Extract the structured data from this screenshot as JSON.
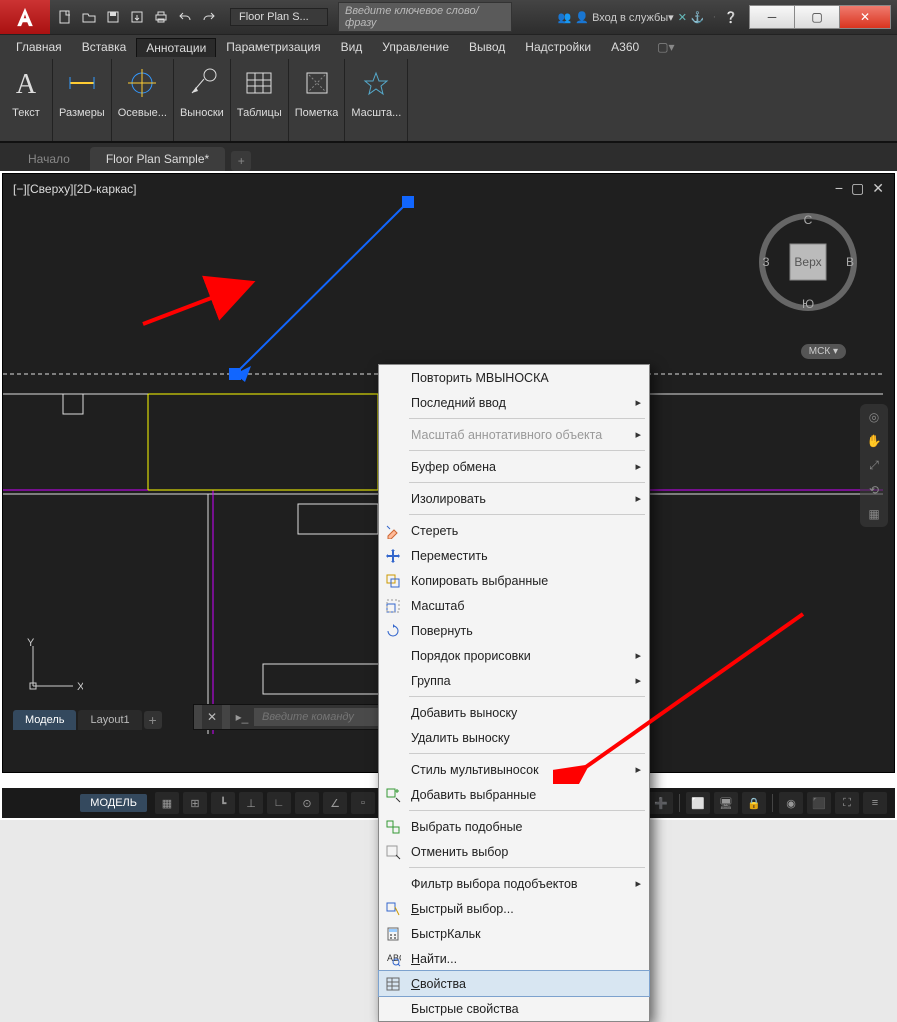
{
  "titlebar": {
    "doc_title": "Floor Plan S...",
    "search_placeholder": "Введите ключевое слово/фразу",
    "login": "Вход в службы"
  },
  "menu": {
    "items": [
      "Главная",
      "Вставка",
      "Аннотации",
      "Параметризация",
      "Вид",
      "Управление",
      "Вывод",
      "Надстройки",
      "A360"
    ],
    "active_index": 2
  },
  "ribbon": {
    "groups": [
      {
        "label": "Текст"
      },
      {
        "label": "Размеры"
      },
      {
        "label": "Осевые..."
      },
      {
        "label": "Выноски"
      },
      {
        "label": "Таблицы"
      },
      {
        "label": "Пометка"
      },
      {
        "label": "Масшта..."
      }
    ]
  },
  "doctabs": {
    "inactive": "Начало",
    "active": "Floor Plan Sample*"
  },
  "view": {
    "label": "[−][Сверху][2D-каркас]",
    "cube": {
      "n": "С",
      "s": "Ю",
      "e": "В",
      "w": "З",
      "face": "Верх"
    },
    "wcs": "МСК"
  },
  "ucs": {
    "x": "X",
    "y": "Y"
  },
  "layout_tabs": {
    "model": "Модель",
    "layout1": "Layout1"
  },
  "cmdline": {
    "placeholder": "Введите команду"
  },
  "statusbar": {
    "model": "МОДЕЛЬ"
  },
  "context_menu": {
    "items": [
      {
        "label": "Повторить МВЫНОСКА"
      },
      {
        "label": "Последний ввод",
        "sub": true
      },
      {
        "sep": true
      },
      {
        "label": "Масштаб аннотативного объекта",
        "sub": true,
        "disabled": true
      },
      {
        "sep": true
      },
      {
        "label": "Буфер обмена",
        "sub": true
      },
      {
        "sep": true
      },
      {
        "label": "Изолировать",
        "sub": true
      },
      {
        "sep": true
      },
      {
        "label": "Стереть",
        "icon": "erase"
      },
      {
        "label": "Переместить",
        "icon": "move"
      },
      {
        "label": "Копировать выбранные",
        "icon": "copy"
      },
      {
        "label": "Масштаб",
        "icon": "scale"
      },
      {
        "label": "Повернуть",
        "icon": "rotate"
      },
      {
        "label": "Порядок прорисовки",
        "sub": true
      },
      {
        "label": "Группа",
        "sub": true
      },
      {
        "sep": true
      },
      {
        "label": "Добавить выноску"
      },
      {
        "label": "Удалить выноску"
      },
      {
        "sep": true
      },
      {
        "label": "Стиль мультивыносок",
        "sub": true
      },
      {
        "label": "Добавить выбранные",
        "icon": "addsel"
      },
      {
        "sep": true
      },
      {
        "label": "Выбрать подобные",
        "icon": "selsim"
      },
      {
        "label": "Отменить выбор",
        "icon": "desel"
      },
      {
        "sep": true
      },
      {
        "label": "Фильтр выбора подобъектов",
        "sub": true
      },
      {
        "label": "Быстрый выбор...",
        "icon": "qsel",
        "underline": 0
      },
      {
        "label": "БыстрКальк",
        "icon": "calc"
      },
      {
        "label": "Найти...",
        "icon": "find",
        "underline": 0
      },
      {
        "label": "Свойства",
        "icon": "props",
        "underline": 0,
        "hover": true
      },
      {
        "label": "Быстрые свойства"
      }
    ]
  }
}
